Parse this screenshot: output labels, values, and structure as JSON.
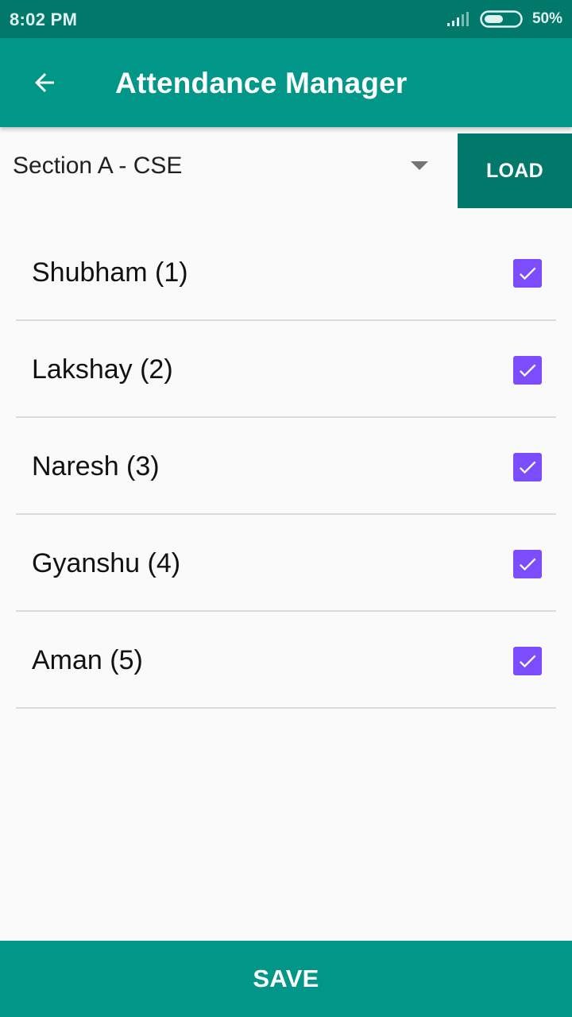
{
  "status_bar": {
    "time": "8:02 PM",
    "battery_percent": "50%",
    "signal_icon": "signal-icon",
    "battery_icon": "battery-icon"
  },
  "app_bar": {
    "title": "Attendance Manager",
    "back_icon": "arrow-back-icon"
  },
  "section_selector": {
    "selected": "Section A - CSE",
    "load_label": "LOAD"
  },
  "students": [
    {
      "label": "Shubham (1)",
      "checked": true
    },
    {
      "label": "Lakshay (2)",
      "checked": true
    },
    {
      "label": "Naresh (3)",
      "checked": true
    },
    {
      "label": "Gyanshu (4)",
      "checked": true
    },
    {
      "label": "Aman (5)",
      "checked": true
    }
  ],
  "save_label": "SAVE",
  "colors": {
    "primary": "#009688",
    "primary_dark": "#00796b",
    "checkbox": "#7c4dff",
    "background": "#fafafa"
  }
}
